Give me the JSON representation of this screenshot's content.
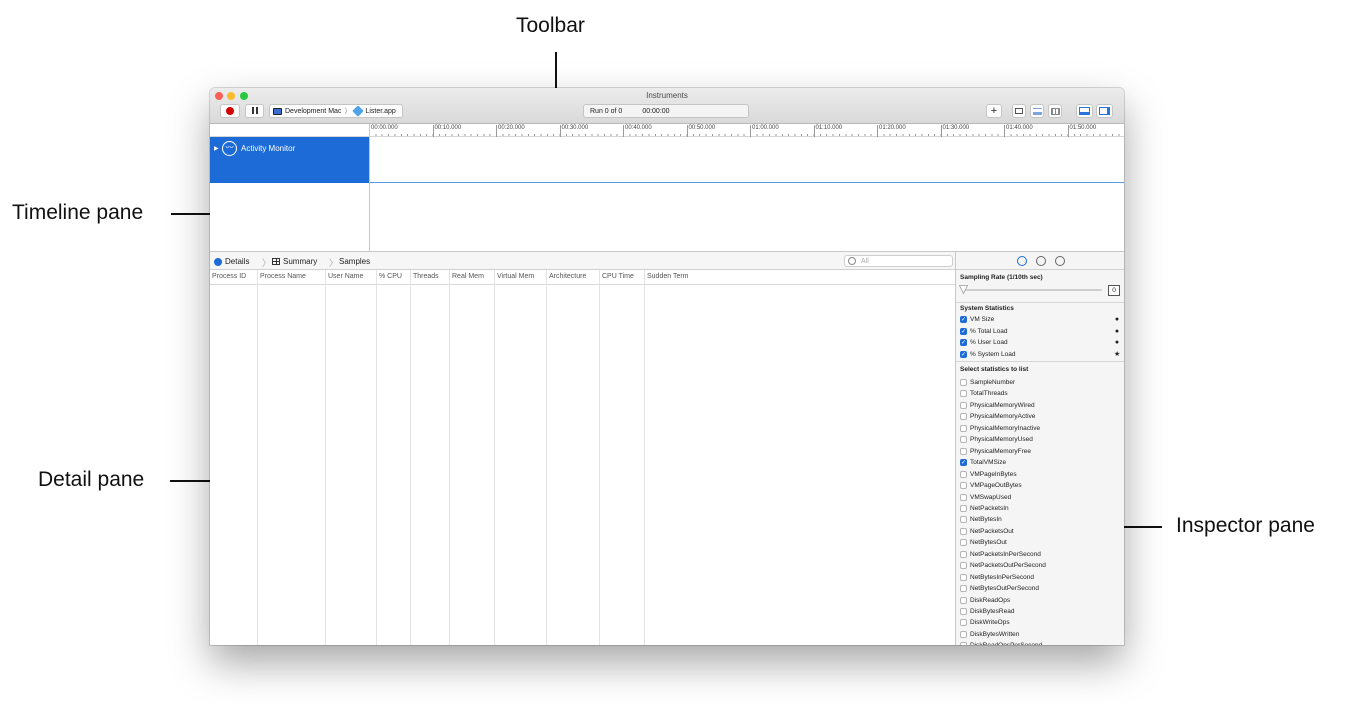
{
  "callouts": {
    "toolbar": "Toolbar",
    "timeline": "Timeline pane",
    "detail": "Detail pane",
    "inspector": "Inspector pane"
  },
  "window": {
    "title": "Instruments",
    "scheme_device": "Development Mac",
    "scheme_target": "Lister.app",
    "run_status": "Run 0 of 0",
    "run_time": "00:00:00",
    "add_label": "+"
  },
  "timeline": {
    "ticks": [
      "00:00.000",
      "00:10.000",
      "00:20.000",
      "00:30.000",
      "00:40.000",
      "00:50.000",
      "01:00.000",
      "01:10.000",
      "01:20.000",
      "01:30.000",
      "01:40.000",
      "01:50.000"
    ],
    "instrument": "Activity Monitor"
  },
  "detail": {
    "jump_details": "Details",
    "jump_summary": "Summary",
    "jump_samples": "Samples",
    "filter_placeholder": "All",
    "columns": [
      "Process ID",
      "Process Name",
      "User Name",
      "% CPU",
      "Threads",
      "Real Mem",
      "Virtual Mem",
      "Architecture",
      "CPU Time",
      "Sudden Term"
    ]
  },
  "inspector": {
    "sampling_title": "Sampling Rate (1/10th sec)",
    "sampling_value": "0",
    "system_title": "System Statistics",
    "system_stats": [
      {
        "label": "VM Size",
        "marker": "●"
      },
      {
        "label": "% Total Load",
        "marker": "●"
      },
      {
        "label": "% User Load",
        "marker": "●"
      },
      {
        "label": "% System Load",
        "marker": "★"
      }
    ],
    "select_title": "Select statistics to list",
    "stats": [
      {
        "label": "SampleNumber",
        "checked": false
      },
      {
        "label": "TotalThreads",
        "checked": false
      },
      {
        "label": "PhysicalMemoryWired",
        "checked": false
      },
      {
        "label": "PhysicalMemoryActive",
        "checked": false
      },
      {
        "label": "PhysicalMemoryInactive",
        "checked": false
      },
      {
        "label": "PhysicalMemoryUsed",
        "checked": false
      },
      {
        "label": "PhysicalMemoryFree",
        "checked": false
      },
      {
        "label": "TotalVMSize",
        "checked": true
      },
      {
        "label": "VMPageInBytes",
        "checked": false
      },
      {
        "label": "VMPageOutBytes",
        "checked": false
      },
      {
        "label": "VMSwapUsed",
        "checked": false
      },
      {
        "label": "NetPacketsIn",
        "checked": false
      },
      {
        "label": "NetBytesIn",
        "checked": false
      },
      {
        "label": "NetPacketsOut",
        "checked": false
      },
      {
        "label": "NetBytesOut",
        "checked": false
      },
      {
        "label": "NetPacketsInPerSecond",
        "checked": false
      },
      {
        "label": "NetPacketsOutPerSecond",
        "checked": false
      },
      {
        "label": "NetBytesInPerSecond",
        "checked": false
      },
      {
        "label": "NetBytesOutPerSecond",
        "checked": false
      },
      {
        "label": "DiskReadOps",
        "checked": false
      },
      {
        "label": "DiskBytesRead",
        "checked": false
      },
      {
        "label": "DiskWriteOps",
        "checked": false
      },
      {
        "label": "DiskBytesWritten",
        "checked": false
      },
      {
        "label": "DiskReadOpsPerSecond",
        "checked": false
      }
    ]
  }
}
